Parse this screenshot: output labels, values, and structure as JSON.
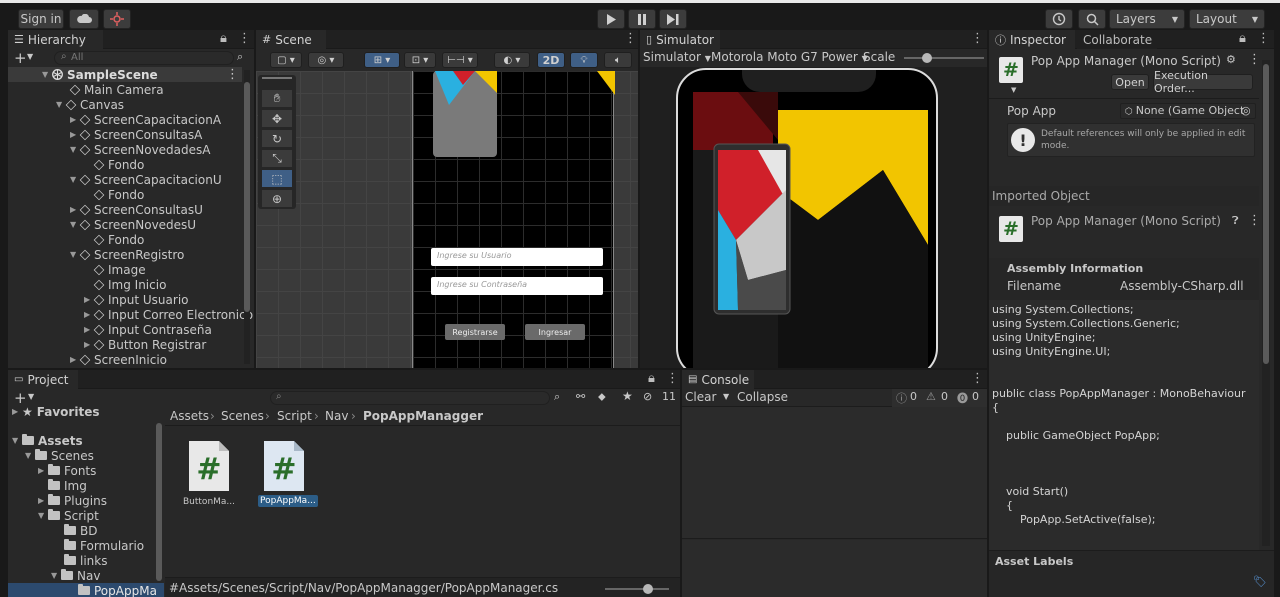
{
  "toolbar": {
    "sign_in": "Sign in",
    "layers": "Layers",
    "layout": "Layout"
  },
  "hierarchy": {
    "tab": "Hierarchy",
    "search_placeholder": "All",
    "items": [
      {
        "label": "SampleScene"
      },
      {
        "label": "Main Camera"
      },
      {
        "label": "Canvas"
      },
      {
        "label": "ScreenCapacitacionA"
      },
      {
        "label": "ScreenConsultasA"
      },
      {
        "label": "ScreenNovedadesA"
      },
      {
        "label": "Fondo"
      },
      {
        "label": "ScreenCapacitacionU"
      },
      {
        "label": "Fondo"
      },
      {
        "label": "ScreenConsultasU"
      },
      {
        "label": "ScreenNovedesU"
      },
      {
        "label": "Fondo"
      },
      {
        "label": "ScreenRegistro"
      },
      {
        "label": "Image"
      },
      {
        "label": "Img Inicio"
      },
      {
        "label": "Input Usuario"
      },
      {
        "label": "Input Correo Electronico"
      },
      {
        "label": "Input Contraseña"
      },
      {
        "label": "Button Registrar"
      },
      {
        "label": "ScreenInicio"
      }
    ]
  },
  "scene": {
    "tab": "Scene",
    "mode_2d": "2D",
    "input_user_placeholder": "Ingrese su Usuario",
    "input_pass_placeholder": "Ingrese su Contraseña",
    "btn_register": "Registrarse",
    "btn_login": "Ingresar"
  },
  "simulator": {
    "tab": "Simulator",
    "mode": "Simulator",
    "device": "Motorola Moto G7 Power",
    "scale_label": "Scale",
    "scale_value": 0.25
  },
  "inspector": {
    "tab": "Inspector",
    "tab2": "Collaborate",
    "script_title": "Pop App Manager (Mono Script)",
    "open_button": "Open",
    "execution_order_button": "Execution Order...",
    "field_label": "Pop App",
    "field_value": "None (Game Object",
    "info_text": "Default references will only be applied in edit mode.",
    "imported_object": "Imported Object",
    "imported_title": "Pop App Manager (Mono Script)",
    "assembly_info": "Assembly Information",
    "filename_label": "Filename",
    "filename_value": "Assembly-CSharp.dll",
    "code_lines": [
      "using System.Collections;",
      "using System.Collections.Generic;",
      "using UnityEngine;",
      "using UnityEngine.UI;",
      "",
      "",
      "public class PopAppManager : MonoBehaviour",
      "{",
      "",
      "    public GameObject PopApp;",
      "",
      "",
      "",
      "",
      "    void Start()",
      "    {",
      "        PopApp.SetActive(false);"
    ],
    "asset_labels": "Asset Labels"
  },
  "project": {
    "tab": "Project",
    "hidden_count": "11",
    "favorites": "Favorites",
    "tree": [
      {
        "label": "Assets"
      },
      {
        "label": "Scenes"
      },
      {
        "label": "Fonts"
      },
      {
        "label": "Img"
      },
      {
        "label": "Plugins"
      },
      {
        "label": "Script"
      },
      {
        "label": "BD"
      },
      {
        "label": "Formulario"
      },
      {
        "label": "links"
      },
      {
        "label": "Nav"
      },
      {
        "label": "PopAppMa"
      }
    ],
    "breadcrumb": [
      "Assets",
      "Scenes",
      "Script",
      "Nav",
      "PopAppManagger"
    ],
    "files": [
      {
        "label": "ButtonMa..."
      },
      {
        "label": "PopAppMa..."
      }
    ],
    "path": "Assets/Scenes/Script/Nav/PopAppManagger/PopAppManager.cs"
  },
  "console": {
    "tab": "Console",
    "clear": "Clear",
    "collapse": "Collapse",
    "info_count": "0",
    "warn_count": "0",
    "error_count": "0"
  },
  "colors": {
    "accent_blue": "#2c5d87",
    "selection": "#2c4a6e",
    "wall_yellow": "#f2c500",
    "wall_red": "#d0202a",
    "wall_blue": "#2ab0e0"
  }
}
